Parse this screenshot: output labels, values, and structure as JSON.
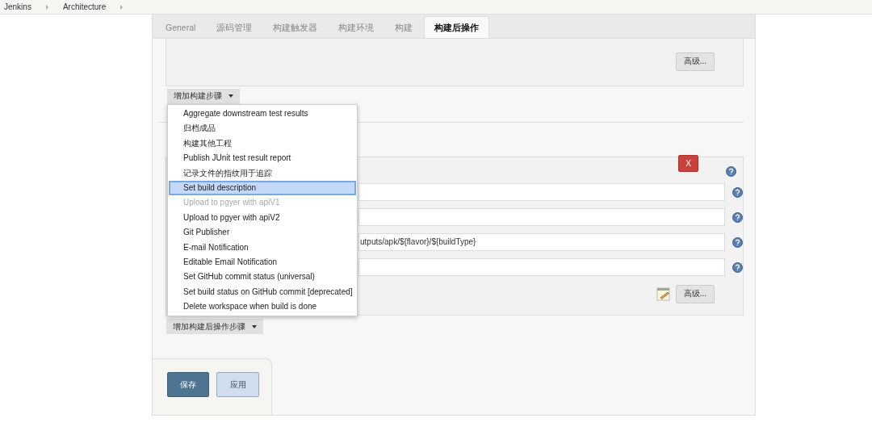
{
  "breadcrumbs": [
    "Jenkins",
    "Architecture"
  ],
  "tabs": [
    {
      "label": "General",
      "selected": false
    },
    {
      "label": "源码管理",
      "selected": false
    },
    {
      "label": "构建触发器",
      "selected": false
    },
    {
      "label": "构建环境",
      "selected": false
    },
    {
      "label": "构建",
      "selected": false
    },
    {
      "label": "构建后操作",
      "selected": true
    }
  ],
  "build_section": {
    "advanced_button": "高级...",
    "add_step_button": "增加构建步骤"
  },
  "menu": {
    "items": [
      {
        "label": "Aggregate downstream test results",
        "selected": false,
        "disabled": false
      },
      {
        "label": "归档成品",
        "selected": false,
        "disabled": false
      },
      {
        "label": "构建其他工程",
        "selected": false,
        "disabled": false
      },
      {
        "label": "Publish JUnit test result report",
        "selected": false,
        "disabled": false
      },
      {
        "label": "记录文件的指纹用于追踪",
        "selected": false,
        "disabled": false
      },
      {
        "label": "Set build description",
        "selected": true,
        "disabled": false
      },
      {
        "label": "Upload to pgyer with apiV1",
        "selected": false,
        "disabled": true
      },
      {
        "label": "Upload to pgyer with apiV2",
        "selected": false,
        "disabled": false
      },
      {
        "label": "Git Publisher",
        "selected": false,
        "disabled": false
      },
      {
        "label": "E-mail Notification",
        "selected": false,
        "disabled": false
      },
      {
        "label": "Editable Email Notification",
        "selected": false,
        "disabled": false
      },
      {
        "label": "Set GitHub commit status (universal)",
        "selected": false,
        "disabled": false
      },
      {
        "label": "Set build status on GitHub commit [deprecated]",
        "selected": false,
        "disabled": false
      },
      {
        "label": "Delete workspace when build is done",
        "selected": false,
        "disabled": false
      }
    ]
  },
  "post_build_section": {
    "delete_button": "X",
    "fields": [
      {
        "kind": "text"
      },
      {
        "kind": "text"
      },
      {
        "kind": "text",
        "value": "utputs/apk/${flavor}/${buildType}"
      },
      {
        "kind": "text"
      }
    ],
    "advanced_button": "高级...",
    "add_step_button": "增加构建后操作步骤"
  },
  "footer": {
    "save_button": "保存",
    "apply_button": "应用"
  }
}
